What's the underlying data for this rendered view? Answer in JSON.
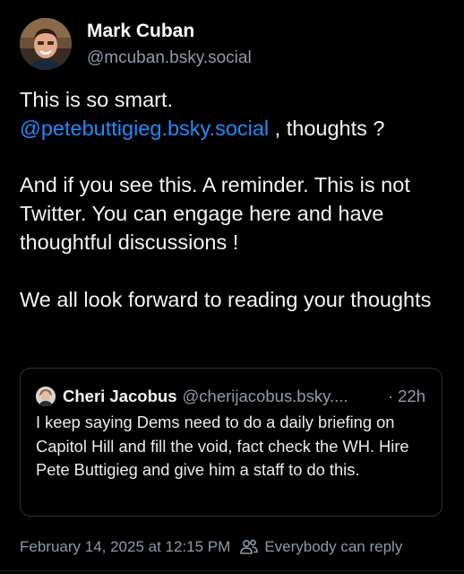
{
  "author": {
    "name": "Mark Cuban",
    "handle": "@mcuban.bsky.social"
  },
  "post": {
    "line1": "This is so smart.",
    "mention": "@petebuttigieg.bsky.social",
    "mention_suffix": " , thoughts ?",
    "paragraph2": "And if you see this.  A reminder. This is not Twitter.  You can engage here and have thoughtful discussions !",
    "paragraph3": "We all look forward to reading your thoughts"
  },
  "quote": {
    "name": "Cheri Jacobus",
    "handle": "@cherijacobus.bsky....",
    "time": "· 22h",
    "text": "I keep saying Dems need to do a daily briefing on Capitol Hill and fill the void, fact check the WH.  Hire Pete Buttigieg and give him a staff to do this."
  },
  "footer": {
    "timestamp": "February 14, 2025 at 12:15 PM",
    "reply_setting": "Everybody can reply"
  },
  "colors": {
    "background": "#000000",
    "link": "#208bfe",
    "muted": "#8e9aab",
    "border": "#2e3439"
  },
  "icons": {
    "reply_setting_icon": "people-icon"
  }
}
